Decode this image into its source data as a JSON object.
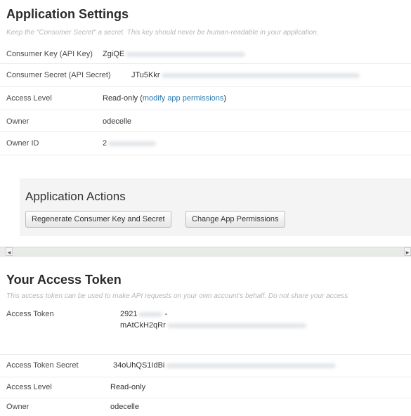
{
  "app_settings": {
    "title": "Application Settings",
    "note": "Keep the \"Consumer Secret\" a secret. This key should never be human-readable in your application.",
    "rows": [
      {
        "label": "Consumer Key (API Key)",
        "value": "ZgiQE"
      },
      {
        "label": "Consumer Secret (API Secret)",
        "value": "JTu5Kkr"
      },
      {
        "label": "Access Level",
        "value": "Read-only (",
        "link": "modify app permissions",
        "after": ")"
      },
      {
        "label": "Owner",
        "value": "odecelle"
      },
      {
        "label": "Owner ID",
        "value": "2"
      }
    ]
  },
  "app_actions": {
    "title": "Application Actions",
    "regenerate_button": "Regenerate Consumer Key and Secret",
    "change_permissions_button": "Change App Permissions"
  },
  "scrollbar": {
    "left_arrow": "◂",
    "right_arrow": "▸"
  },
  "access_token": {
    "title": "Your Access Token",
    "note": "This access token can be used to make API requests on your own account's behalf. Do not share your access",
    "rows": [
      {
        "label": "Access Token",
        "value_line1": "2921",
        "value_line1_suffix": "-",
        "value_line2": "mAtCkH2qRr"
      },
      {
        "label": "Access Token Secret",
        "value": "34oUhQS1IdBi"
      },
      {
        "label": "Access Level",
        "value": "Read-only"
      },
      {
        "label": "Owner",
        "value": "odecelle"
      }
    ]
  }
}
